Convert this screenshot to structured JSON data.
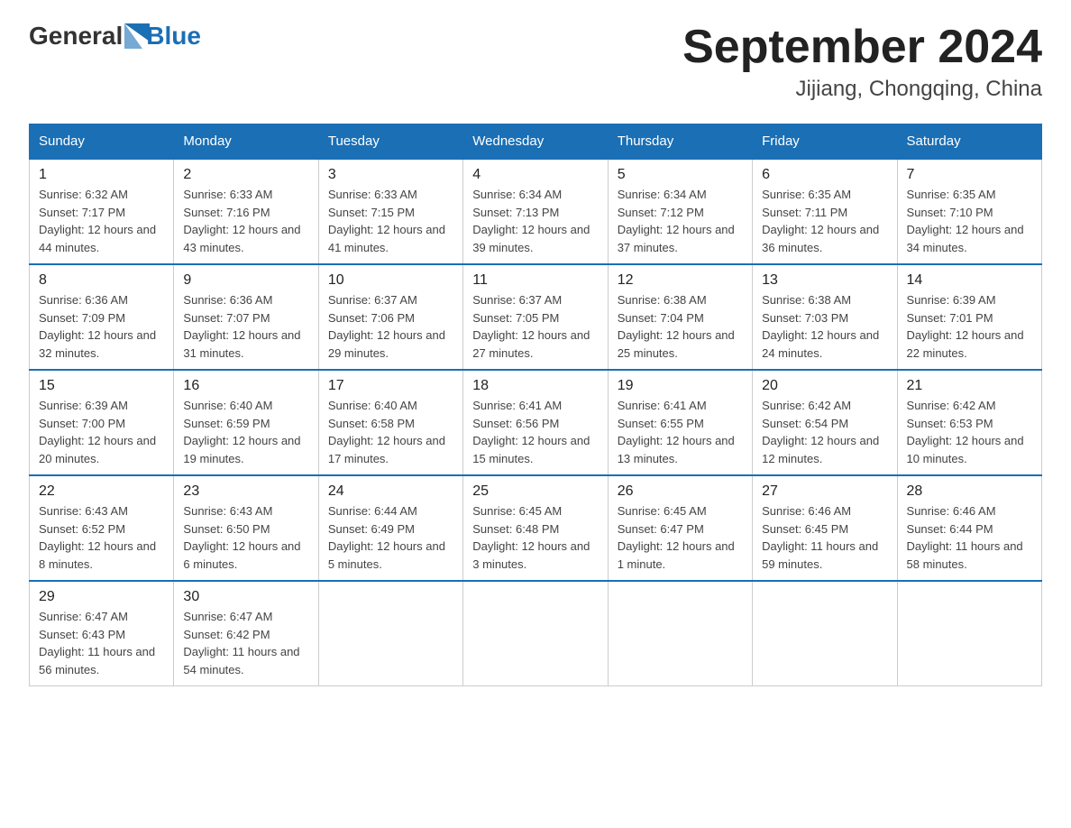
{
  "header": {
    "logo": {
      "text_general": "General",
      "text_blue": "Blue"
    },
    "title": "September 2024",
    "location": "Jijiang, Chongqing, China"
  },
  "weekdays": [
    "Sunday",
    "Monday",
    "Tuesday",
    "Wednesday",
    "Thursday",
    "Friday",
    "Saturday"
  ],
  "weeks": [
    [
      {
        "day": "1",
        "sunrise": "6:32 AM",
        "sunset": "7:17 PM",
        "daylight": "12 hours and 44 minutes."
      },
      {
        "day": "2",
        "sunrise": "6:33 AM",
        "sunset": "7:16 PM",
        "daylight": "12 hours and 43 minutes."
      },
      {
        "day": "3",
        "sunrise": "6:33 AM",
        "sunset": "7:15 PM",
        "daylight": "12 hours and 41 minutes."
      },
      {
        "day": "4",
        "sunrise": "6:34 AM",
        "sunset": "7:13 PM",
        "daylight": "12 hours and 39 minutes."
      },
      {
        "day": "5",
        "sunrise": "6:34 AM",
        "sunset": "7:12 PM",
        "daylight": "12 hours and 37 minutes."
      },
      {
        "day": "6",
        "sunrise": "6:35 AM",
        "sunset": "7:11 PM",
        "daylight": "12 hours and 36 minutes."
      },
      {
        "day": "7",
        "sunrise": "6:35 AM",
        "sunset": "7:10 PM",
        "daylight": "12 hours and 34 minutes."
      }
    ],
    [
      {
        "day": "8",
        "sunrise": "6:36 AM",
        "sunset": "7:09 PM",
        "daylight": "12 hours and 32 minutes."
      },
      {
        "day": "9",
        "sunrise": "6:36 AM",
        "sunset": "7:07 PM",
        "daylight": "12 hours and 31 minutes."
      },
      {
        "day": "10",
        "sunrise": "6:37 AM",
        "sunset": "7:06 PM",
        "daylight": "12 hours and 29 minutes."
      },
      {
        "day": "11",
        "sunrise": "6:37 AM",
        "sunset": "7:05 PM",
        "daylight": "12 hours and 27 minutes."
      },
      {
        "day": "12",
        "sunrise": "6:38 AM",
        "sunset": "7:04 PM",
        "daylight": "12 hours and 25 minutes."
      },
      {
        "day": "13",
        "sunrise": "6:38 AM",
        "sunset": "7:03 PM",
        "daylight": "12 hours and 24 minutes."
      },
      {
        "day": "14",
        "sunrise": "6:39 AM",
        "sunset": "7:01 PM",
        "daylight": "12 hours and 22 minutes."
      }
    ],
    [
      {
        "day": "15",
        "sunrise": "6:39 AM",
        "sunset": "7:00 PM",
        "daylight": "12 hours and 20 minutes."
      },
      {
        "day": "16",
        "sunrise": "6:40 AM",
        "sunset": "6:59 PM",
        "daylight": "12 hours and 19 minutes."
      },
      {
        "day": "17",
        "sunrise": "6:40 AM",
        "sunset": "6:58 PM",
        "daylight": "12 hours and 17 minutes."
      },
      {
        "day": "18",
        "sunrise": "6:41 AM",
        "sunset": "6:56 PM",
        "daylight": "12 hours and 15 minutes."
      },
      {
        "day": "19",
        "sunrise": "6:41 AM",
        "sunset": "6:55 PM",
        "daylight": "12 hours and 13 minutes."
      },
      {
        "day": "20",
        "sunrise": "6:42 AM",
        "sunset": "6:54 PM",
        "daylight": "12 hours and 12 minutes."
      },
      {
        "day": "21",
        "sunrise": "6:42 AM",
        "sunset": "6:53 PM",
        "daylight": "12 hours and 10 minutes."
      }
    ],
    [
      {
        "day": "22",
        "sunrise": "6:43 AM",
        "sunset": "6:52 PM",
        "daylight": "12 hours and 8 minutes."
      },
      {
        "day": "23",
        "sunrise": "6:43 AM",
        "sunset": "6:50 PM",
        "daylight": "12 hours and 6 minutes."
      },
      {
        "day": "24",
        "sunrise": "6:44 AM",
        "sunset": "6:49 PM",
        "daylight": "12 hours and 5 minutes."
      },
      {
        "day": "25",
        "sunrise": "6:45 AM",
        "sunset": "6:48 PM",
        "daylight": "12 hours and 3 minutes."
      },
      {
        "day": "26",
        "sunrise": "6:45 AM",
        "sunset": "6:47 PM",
        "daylight": "12 hours and 1 minute."
      },
      {
        "day": "27",
        "sunrise": "6:46 AM",
        "sunset": "6:45 PM",
        "daylight": "11 hours and 59 minutes."
      },
      {
        "day": "28",
        "sunrise": "6:46 AM",
        "sunset": "6:44 PM",
        "daylight": "11 hours and 58 minutes."
      }
    ],
    [
      {
        "day": "29",
        "sunrise": "6:47 AM",
        "sunset": "6:43 PM",
        "daylight": "11 hours and 56 minutes."
      },
      {
        "day": "30",
        "sunrise": "6:47 AM",
        "sunset": "6:42 PM",
        "daylight": "11 hours and 54 minutes."
      },
      null,
      null,
      null,
      null,
      null
    ]
  ]
}
